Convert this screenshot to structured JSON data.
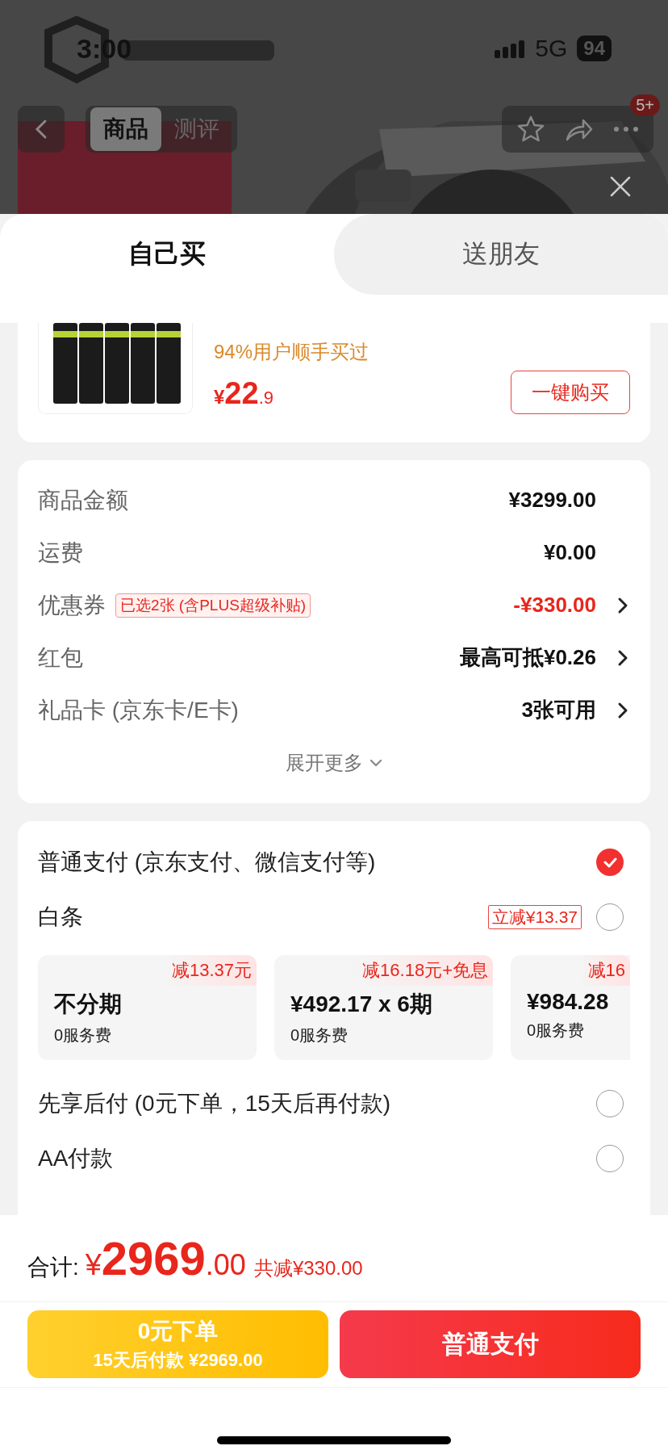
{
  "status_bar": {
    "time": "3:00",
    "network": "5G",
    "battery": "94"
  },
  "nav": {
    "tabs": [
      {
        "label": "商品",
        "selected": true
      },
      {
        "label": "测评",
        "selected": false
      }
    ],
    "badge": "5+"
  },
  "sheet_tabs": [
    {
      "label": "自己买",
      "selected": true
    },
    {
      "label": "送朋友",
      "selected": false
    }
  ],
  "recommendation": {
    "note": "94%用户顺手买过",
    "price_symbol": "¥",
    "price_main": "22",
    "price_decimal": ".9",
    "button": "一键购买"
  },
  "costs": {
    "rows": [
      {
        "label": "商品金额",
        "value": "¥3299.00",
        "discount": false,
        "arrow": false
      },
      {
        "label": "运费",
        "value": "¥0.00",
        "discount": false,
        "arrow": false
      },
      {
        "label": "优惠券",
        "tag": "已选2张 (含PLUS超级补贴)",
        "value": "-¥330.00",
        "discount": true,
        "arrow": true
      },
      {
        "label": "红包",
        "value": "最高可抵¥0.26",
        "discount": false,
        "arrow": true
      },
      {
        "label": "礼品卡 (京东卡/E卡)",
        "value": "3张可用",
        "discount": false,
        "arrow": true
      }
    ],
    "more": "展开更多"
  },
  "payment": {
    "methods": [
      {
        "label": "普通支付 (京东支付、微信支付等)",
        "selected": true
      },
      {
        "label": "白条",
        "tag": "立减¥13.37",
        "selected": false,
        "plans": [
          {
            "promo": "减13.37元",
            "title": "不分期",
            "fee": "0服务费"
          },
          {
            "promo": "减16.18元+免息",
            "title": "¥492.17 x 6期",
            "fee": "0服务费"
          },
          {
            "promo": "减16",
            "title": "¥984.28",
            "fee": "0服务费"
          }
        ]
      },
      {
        "label": "先享后付 (0元下单，15天后再付款)",
        "selected": false
      },
      {
        "label": "AA付款",
        "selected": false
      }
    ]
  },
  "total": {
    "label": "合计:",
    "symbol": "¥",
    "main": "2969",
    "decimal": ".00",
    "saving": "共减¥330.00"
  },
  "actions": [
    {
      "kind": "later",
      "title": "0元下单",
      "subtitle": "15天后付款 ¥2969.00"
    },
    {
      "kind": "primary",
      "title": "普通支付"
    }
  ]
}
